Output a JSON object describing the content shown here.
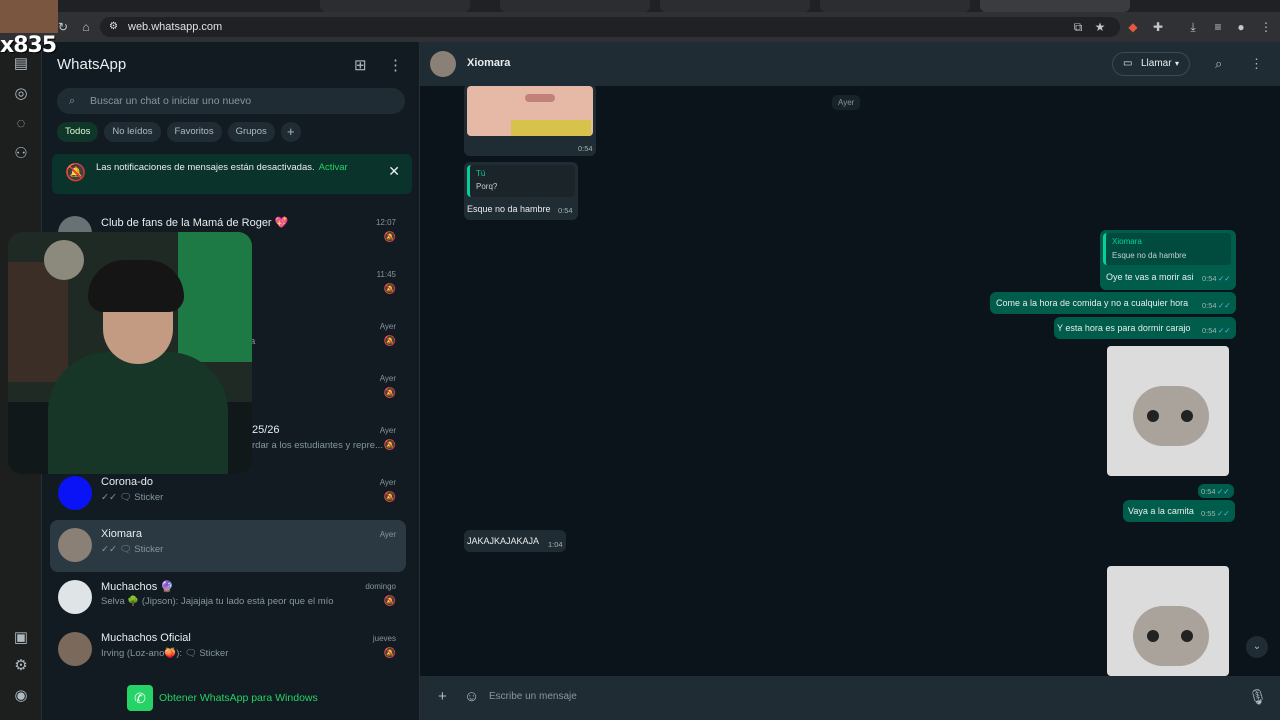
{
  "browser": {
    "url": "web.whatsapp.com"
  },
  "overlay": {
    "tag": "x835"
  },
  "app": {
    "title": "WhatsApp"
  },
  "search": {
    "placeholder": "Buscar un chat o iniciar uno nuevo"
  },
  "filters": [
    "Todos",
    "No leídos",
    "Favoritos",
    "Grupos"
  ],
  "notification": {
    "text": "Las notificaciones de mensajes están desactivadas.",
    "action": "Activar"
  },
  "chats": [
    {
      "name": "Club de fans de la Mamá de Roger 💖",
      "preview": "",
      "time": "12:07"
    },
    {
      "name": "",
      "preview": "",
      "time": "11:45"
    },
    {
      "name": "",
      "preview": "a",
      "time": "Ayer"
    },
    {
      "name": "",
      "preview": "",
      "time": "Ayer"
    },
    {
      "name": "25/26",
      "preview": "rdar a los estudiantes y repre...",
      "time": "Ayer"
    },
    {
      "name": "Corona-do",
      "preview": "✓✓ 🗨 Sticker",
      "time": "Ayer"
    },
    {
      "name": "Xiomara",
      "preview": "✓✓ 🗨 Sticker",
      "time": "Ayer"
    },
    {
      "name": "Muchachos 🔮",
      "preview": "Selva 🌳 (Jipson): Jajajaja tu lado está peor que el mío",
      "time": "domingo"
    },
    {
      "name": "Muchachos Oficial",
      "preview": "Irving (Loz-ano🍑): 🗨 Sticker",
      "time": "jueves"
    }
  ],
  "get_app": {
    "label": "Obtener WhatsApp para Windows"
  },
  "conversation": {
    "contact": "Xiomara",
    "call_label": "Llamar",
    "day_label": "Ayer",
    "messages": {
      "img1_time": "0:54",
      "reply_quote_name": "Tú",
      "reply_quote_text": "Porq?",
      "reply_text": "Esque no da hambre",
      "reply_time": "0:54",
      "out_quote_name": "Xiomara",
      "out_quote_text": "Esque no da hambre",
      "out1_text": "Oye te vas a morir asi",
      "out1_time": "0:54",
      "out2_text": "Come a la hora de comida y no a cualquier hora",
      "out2_time": "0:54",
      "out3_text": "Y esta hora es para dormir carajo",
      "out3_time": "0:54",
      "sticker_time": "0:54",
      "out4_text": "Vaya a la camita",
      "out4_time": "0:55",
      "in2_text": "JAKAJKAJAKAJA",
      "in2_time": "1:04"
    },
    "composer_placeholder": "Escribe un mensaje"
  }
}
